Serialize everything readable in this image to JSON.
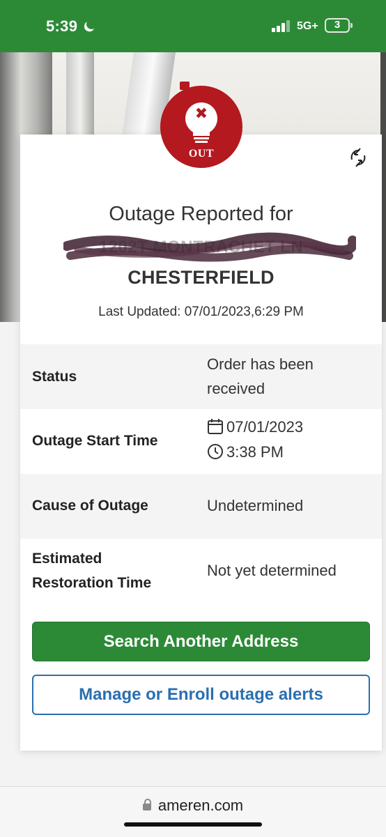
{
  "status_bar": {
    "time": "5:39",
    "network": "5G+",
    "battery": "3",
    "background_color": "#2c8a37"
  },
  "card": {
    "badge_label": "OUT",
    "title": "Outage Reported for",
    "address_redacted": "1202T MONTRACHET LN",
    "city": "CHESTERFIELD",
    "last_updated": "Last Updated: 07/01/2023,6:29 PM",
    "rows": {
      "status": {
        "label": "Status",
        "value_line1": "Order has been",
        "value_line2": "received"
      },
      "start_time": {
        "label": "Outage Start Time",
        "date": "07/01/2023",
        "time": "3:38 PM"
      },
      "cause": {
        "label": "Cause of Outage",
        "value": "Undetermined"
      },
      "restoration": {
        "label_line1": "Estimated",
        "label_line2": "Restoration Time",
        "value": "Not yet determined"
      }
    },
    "buttons": {
      "search_another": "Search Another Address",
      "manage_alerts": "Manage or Enroll outage alerts"
    }
  },
  "browser": {
    "url": "ameren.com"
  },
  "colors": {
    "brand_green": "#2c8a37",
    "alert_red": "#b3191f",
    "link_blue": "#2a6fb0"
  },
  "icons": [
    "moon-icon",
    "signal-icon",
    "battery-icon",
    "lightbulb-x-icon",
    "refresh-icon",
    "calendar-icon",
    "clock-icon",
    "lock-icon"
  ]
}
